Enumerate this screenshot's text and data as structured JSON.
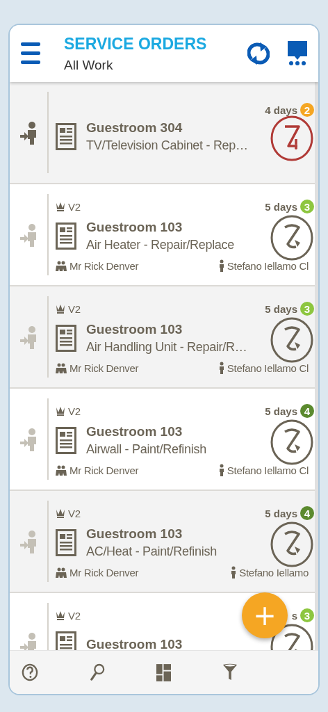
{
  "header": {
    "title": "SERVICE ORDERS",
    "subtitle": "All Work"
  },
  "orders": [
    {
      "assigned": true,
      "title": "Guestroom 304",
      "subtitle": "TV/Television Cabinet - Rep…",
      "days": "4 days",
      "count": "2",
      "color": "#f5a623",
      "status": {
        "kind": "alert"
      }
    },
    {
      "assigned": false,
      "version": "V2",
      "title": "Guestroom 103",
      "subtitle": "Air Heater - Repair/Replace",
      "days": "5 days",
      "count": "3",
      "color": "#8dc63f",
      "status": {
        "kind": "pending"
      },
      "requester": "Mr Rick Denver",
      "assignee": "Stefano Iellamo Cl"
    },
    {
      "assigned": false,
      "version": "V2",
      "title": "Guestroom 103",
      "subtitle": "Air Handling Unit - Repair/R…",
      "days": "5 days",
      "count": "3",
      "color": "#8dc63f",
      "status": {
        "kind": "pending"
      },
      "requester": "Mr Rick Denver",
      "assignee": "Stefano Iellamo Cl"
    },
    {
      "assigned": false,
      "version": "V2",
      "title": "Guestroom 103",
      "subtitle": "Airwall - Paint/Refinish",
      "days": "5 days",
      "count": "4",
      "color": "#5b8a2e",
      "status": {
        "kind": "pending"
      },
      "requester": "Mr Rick Denver",
      "assignee": "Stefano Iellamo Cl"
    },
    {
      "assigned": false,
      "version": "V2",
      "title": "Guestroom 103",
      "subtitle": "AC/Heat - Paint/Refinish",
      "days": "5 days",
      "count": "4",
      "color": "#5b8a2e",
      "status": {
        "kind": "pending"
      },
      "requester": "Mr Rick Denver",
      "assignee": "Stefano Iellamo"
    },
    {
      "assigned": false,
      "version": "V2",
      "title": "Guestroom 103",
      "days": "s",
      "count": "3",
      "color": "#8dc63f",
      "status": {
        "kind": "pending"
      }
    }
  ],
  "fab": {
    "label": "+"
  }
}
